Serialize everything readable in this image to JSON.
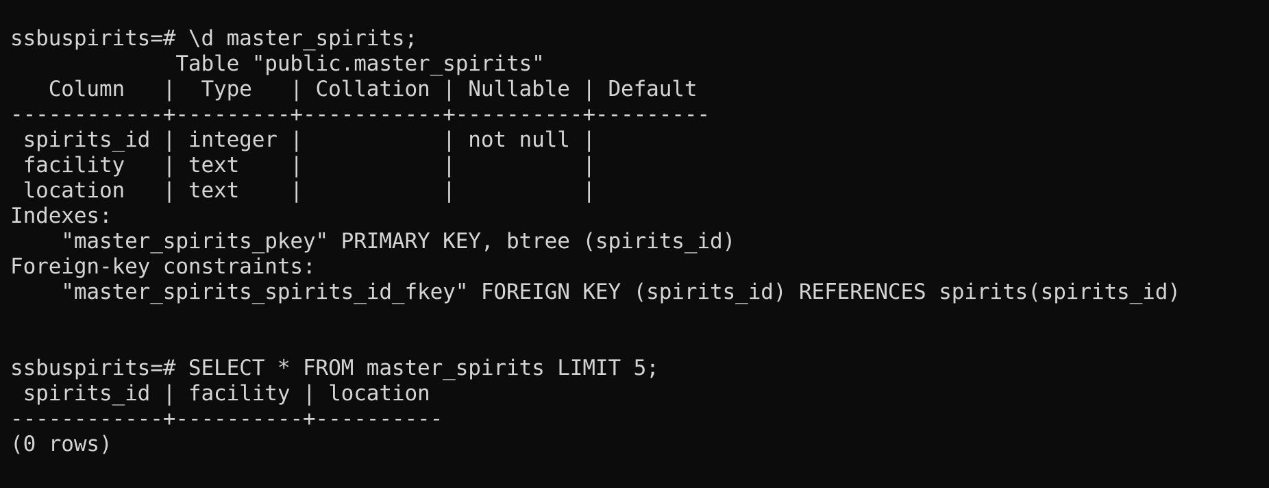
{
  "terminal": {
    "lines": [
      "ssbuspirits=# \\d master_spirits;",
      "             Table \"public.master_spirits\"",
      "   Column   |  Type   | Collation | Nullable | Default",
      "------------+---------+-----------+----------+---------",
      " spirits_id | integer |           | not null |",
      " facility   | text    |           |          |",
      " location   | text    |           |          |",
      "Indexes:",
      "    \"master_spirits_pkey\" PRIMARY KEY, btree (spirits_id)",
      "Foreign-key constraints:",
      "    \"master_spirits_spirits_id_fkey\" FOREIGN KEY (spirits_id) REFERENCES spirits(spirits_id)",
      "",
      "",
      "ssbuspirits=# SELECT * FROM master_spirits LIMIT 5;",
      " spirits_id | facility | location",
      "------------+----------+----------",
      "(0 rows)"
    ]
  }
}
